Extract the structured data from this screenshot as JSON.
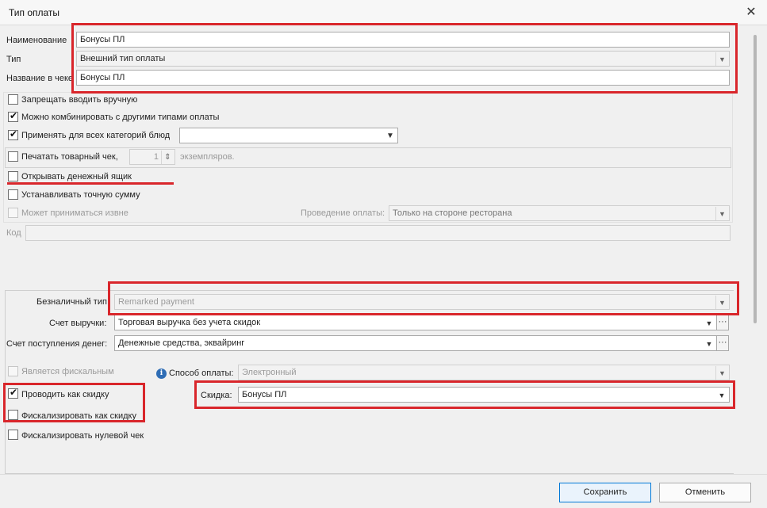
{
  "window": {
    "title": "Тип оплаты",
    "close_symbol": "✕"
  },
  "fields": {
    "name": {
      "label": "Наименование",
      "value": "Бонусы ПЛ"
    },
    "type": {
      "label": "Тип",
      "value": "Внешний тип оплаты"
    },
    "receipt_name": {
      "label": "Название в чеке",
      "value": "Бонусы ПЛ"
    },
    "code": {
      "label": "Код",
      "value": ""
    }
  },
  "checkboxes": {
    "forbid_manual": {
      "label": "Запрещать вводить вручную",
      "checked": false
    },
    "can_combine": {
      "label": "Можно комбинировать с другими типами оплаты",
      "checked": true
    },
    "apply_all_categories": {
      "label": "Применять для всех категорий блюд",
      "checked": true
    },
    "print_receipt": {
      "label": "Печатать товарный чек,",
      "checked": false
    },
    "open_cash_drawer": {
      "label": "Открывать денежный ящик",
      "checked": false
    },
    "exact_sum": {
      "label": "Устанавливать точную сумму",
      "checked": false
    },
    "accept_external": {
      "label": "Может приниматься извне",
      "checked": false
    },
    "is_fiscal": {
      "label": "Является фискальным",
      "checked": false
    },
    "as_discount": {
      "label": "Проводить как скидку",
      "checked": true
    },
    "fiscalize_discount": {
      "label": "Фискализировать как скидку",
      "checked": false
    },
    "fiscalize_zero": {
      "label": "Фискализировать нулевой чек",
      "checked": false
    }
  },
  "copies": {
    "value": "1",
    "suffix": "экземпляров."
  },
  "categories_select": {
    "value": ""
  },
  "payment_processing": {
    "label": "Проведение оплаты:",
    "value": "Только на стороне ресторана"
  },
  "payment_panel": {
    "cashless_type": {
      "label": "Безналичный тип:",
      "value": "Remarked payment"
    },
    "revenue_account": {
      "label": "Счет выручки:",
      "value": "Торговая выручка без учета скидок"
    },
    "money_account": {
      "label": "Счет поступления денег:",
      "value": "Денежные средства, эквайринг"
    },
    "payment_method": {
      "label": "Способ оплаты:",
      "value": "Электронный"
    },
    "discount": {
      "label": "Скидка:",
      "value": "Бонусы ПЛ"
    }
  },
  "buttons": {
    "save": "Сохранить",
    "cancel": "Отменить"
  },
  "icons": {
    "dropdown": "▼",
    "ellipsis": "···",
    "check": "✔",
    "info": "i",
    "spin": "⇕"
  },
  "colors": {
    "highlight": "#d9262b",
    "primary_border": "#0078d7",
    "info_blue": "#2f6db5"
  }
}
